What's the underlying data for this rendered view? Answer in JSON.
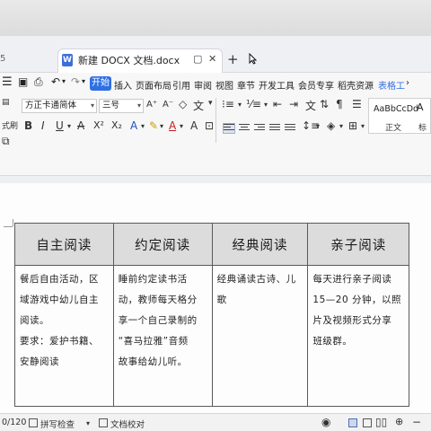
{
  "tabs": {
    "previous_tab_fragment": "5",
    "active_title": "新建 DOCX 文档.docx",
    "doc_icon": "W",
    "new_tab": "+"
  },
  "menu": {
    "items": [
      "开始",
      "插入",
      "页面布局",
      "引用",
      "审阅",
      "视图",
      "章节",
      "开发工具",
      "会员专享",
      "稻壳资源",
      "表格工"
    ],
    "more": "›"
  },
  "ribbon": {
    "paste_label": "粘贴",
    "format_label": "式刷",
    "font_name": "方正卡通简体",
    "font_size": "三号",
    "grow_font": "A⁺",
    "shrink_font": "A⁻",
    "bold": "B",
    "italic": "I",
    "underline": "U",
    "strike": "A",
    "superscript": "X²",
    "subscript": "X₂",
    "style_sample_1": "AaBbCcDd",
    "style_name_1": "正文",
    "style_sample_2": "A",
    "style_name_2": "标"
  },
  "table": {
    "headers": [
      "自主阅读",
      "约定阅读",
      "经典阅读",
      "亲子阅读"
    ],
    "cells": [
      [
        "餐后自由活动，区",
        "域游戏中幼儿自主",
        "阅读。",
        "要求：爱护书籍、",
        "安静阅读"
      ],
      [
        "睡前约定读书活",
        "动，教师每天格分",
        "享一个自己录制的",
        "“喜马拉雅”音频",
        "故事给幼儿听。"
      ],
      [
        "经典诵读古诗、儿",
        "歌"
      ],
      [
        "每天进行亲子阅读",
        "15—20 分钟，以照",
        "片及视频形式分享",
        "班级群。"
      ]
    ]
  },
  "status": {
    "page_count": "0/120",
    "spell_check": "拼写检查",
    "proofread": "文档校对",
    "zoom_minus": "−",
    "zoom_plus": "+"
  }
}
